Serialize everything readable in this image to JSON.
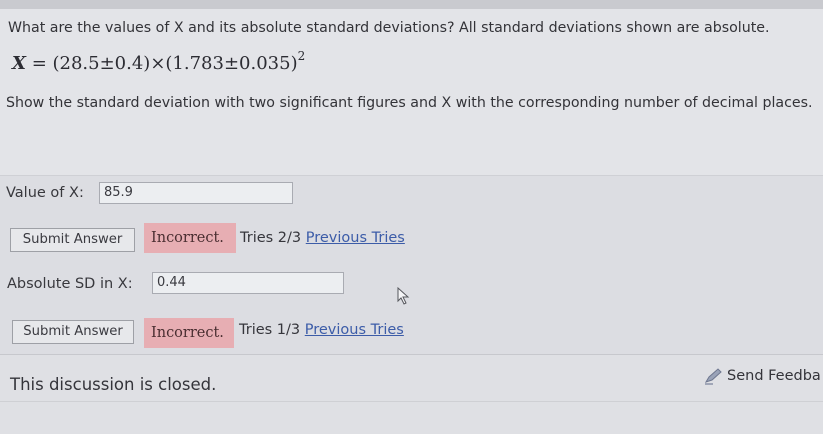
{
  "question": {
    "text": "What are the values of X and its absolute standard deviations? All standard deviations shown are absolute.",
    "formula": {
      "var": "X",
      "rest": " = (28.5±0.4)×(1.783±0.035)",
      "exponent": "2"
    },
    "instruction": "Show the standard deviation with two significant figures and X with the corresponding number of decimal places."
  },
  "part_x": {
    "label": "Value of X:",
    "value": "85.9",
    "submit_label": "Submit Answer",
    "status": "Incorrect.",
    "tries": "Tries 2/3",
    "previous_tries": "Previous Tries"
  },
  "part_sd": {
    "label": "Absolute SD in X:",
    "value": "0.44",
    "submit_label": "Submit Answer",
    "status": "Incorrect.",
    "tries": "Tries 1/3",
    "previous_tries": "Previous Tries"
  },
  "discussion": {
    "closed_text": "This discussion is closed.",
    "feedback_label": "Send Feedba"
  },
  "colors": {
    "incorrect_bg": "#e7aeb3",
    "link": "#3c5ca8",
    "page_bg": "#dcdde2"
  },
  "icons": [
    "pencil-feedback-icon",
    "mouse-cursor-icon"
  ]
}
